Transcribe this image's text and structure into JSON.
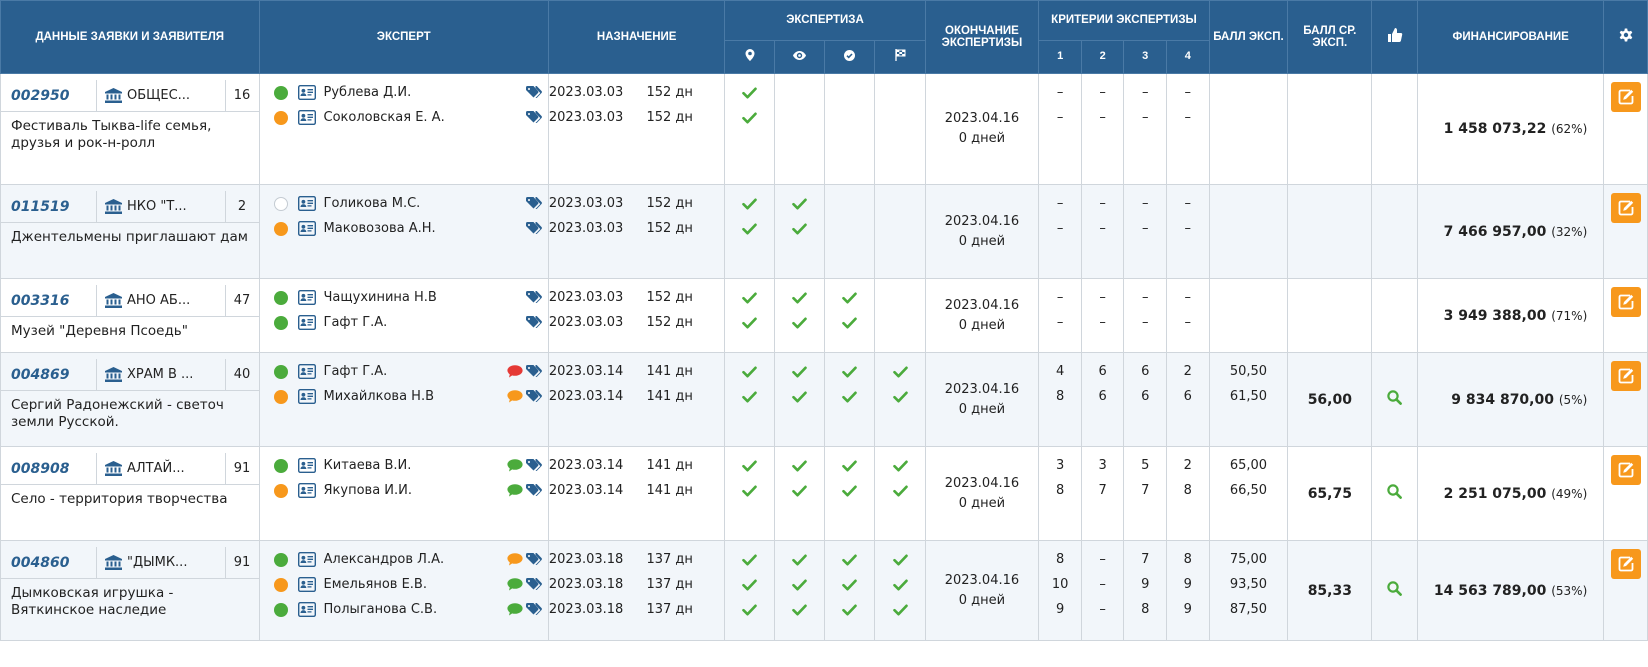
{
  "header": {
    "applicant": "ДАННЫЕ ЗАЯВКИ И ЗАЯВИТЕЛЯ",
    "expert": "ЭКСПЕРТ",
    "assign": "НАЗНАЧЕНИЕ",
    "expertise": "ЭКСПЕРТИЗА",
    "end": "ОКОНЧАНИЕ ЭКСПЕРТИЗЫ",
    "criteria": "КРИТЕРИИ ЭКСПЕРТИЗЫ",
    "crit_nums": [
      "1",
      "2",
      "3",
      "4"
    ],
    "score": "БАЛЛ ЭКСП.",
    "avg_score": "БАЛЛ СР. ЭКСП.",
    "financing": "ФИНАНСИРОВАНИЕ",
    "icons": {
      "stage1": "location-pin-icon",
      "stage2": "eye-icon",
      "stage3": "check-circle-icon",
      "stage4": "flag-icon",
      "like": "thumbs-up-icon",
      "settings": "gear-icon"
    }
  },
  "colors": {
    "header_bg": "#2a5f8f",
    "green": "#4bab3c",
    "orange": "#f7981c",
    "check": "#4bab3c",
    "tag": "#2a5f8f",
    "comment_red": "#e53935",
    "comment_orange": "#f7981c",
    "comment_green": "#4bab3c",
    "link": "#2a5f8f"
  },
  "rows": [
    {
      "code": "002950",
      "org": "ОБЩЕС...",
      "num": "16",
      "title": "Фестиваль Тыква-life семья, друзья и рок-н-ролл",
      "experts": [
        {
          "status": "green",
          "name": "Рублева Д.И.",
          "comment": "",
          "date": "2023.03.03",
          "days": "152 дн",
          "checks": [
            true,
            false,
            false,
            false
          ],
          "crit": [
            "–",
            "–",
            "–",
            "–"
          ],
          "score": ""
        },
        {
          "status": "orange",
          "name": "Соколовская Е. А.",
          "comment": "",
          "date": "2023.03.03",
          "days": "152 дн",
          "checks": [
            true,
            false,
            false,
            false
          ],
          "crit": [
            "–",
            "–",
            "–",
            "–"
          ],
          "score": ""
        }
      ],
      "end_date": "2023.04.16",
      "end_days": "0 дней",
      "avg": "",
      "search": false,
      "fin": "1 458 073,22",
      "pct": "(62%)"
    },
    {
      "code": "011519",
      "org": "НКО \"Т...",
      "num": "2",
      "title": "Джентельмены приглашают дам",
      "experts": [
        {
          "status": "empty",
          "name": "Голикова М.С.",
          "comment": "",
          "date": "2023.03.03",
          "days": "152 дн",
          "checks": [
            true,
            true,
            false,
            false
          ],
          "crit": [
            "–",
            "–",
            "–",
            "–"
          ],
          "score": ""
        },
        {
          "status": "orange",
          "name": "Маковозова А.Н.",
          "comment": "",
          "date": "2023.03.03",
          "days": "152 дн",
          "checks": [
            true,
            true,
            false,
            false
          ],
          "crit": [
            "–",
            "–",
            "–",
            "–"
          ],
          "score": ""
        }
      ],
      "end_date": "2023.04.16",
      "end_days": "0 дней",
      "avg": "",
      "search": false,
      "fin": "7 466 957,00",
      "pct": "(32%)"
    },
    {
      "code": "003316",
      "org": "АНО АБ...",
      "num": "47",
      "title": "Музей \"Деревня Псоедь\"",
      "experts": [
        {
          "status": "green",
          "name": "Чащухинина Н.В",
          "comment": "",
          "date": "2023.03.03",
          "days": "152 дн",
          "checks": [
            true,
            true,
            true,
            false
          ],
          "crit": [
            "–",
            "–",
            "–",
            "–"
          ],
          "score": ""
        },
        {
          "status": "green",
          "name": "Гафт Г.А.",
          "comment": "",
          "date": "2023.03.03",
          "days": "152 дн",
          "checks": [
            true,
            true,
            true,
            false
          ],
          "crit": [
            "–",
            "–",
            "–",
            "–"
          ],
          "score": ""
        }
      ],
      "end_date": "2023.04.16",
      "end_days": "0 дней",
      "avg": "",
      "search": false,
      "fin": "3 949 388,00",
      "pct": "(71%)"
    },
    {
      "code": "004869",
      "org": "ХРАМ В ...",
      "num": "40",
      "title": "Сергий Радонежский - светоч земли Русской.",
      "experts": [
        {
          "status": "green",
          "name": "Гафт Г.А.",
          "comment": "red",
          "date": "2023.03.14",
          "days": "141 дн",
          "checks": [
            true,
            true,
            true,
            true
          ],
          "crit": [
            "4",
            "6",
            "6",
            "2"
          ],
          "score": "50,50"
        },
        {
          "status": "orange",
          "name": "Михайлкова Н.В",
          "comment": "orange",
          "date": "2023.03.14",
          "days": "141 дн",
          "checks": [
            true,
            true,
            true,
            true
          ],
          "crit": [
            "8",
            "6",
            "6",
            "6"
          ],
          "score": "61,50"
        }
      ],
      "end_date": "2023.04.16",
      "end_days": "0 дней",
      "avg": "56,00",
      "search": true,
      "fin": "9 834 870,00",
      "pct": "(5%)"
    },
    {
      "code": "008908",
      "org": "АЛТАЙ...",
      "num": "91",
      "title": "Село - территория творчества",
      "experts": [
        {
          "status": "green",
          "name": "Китаева В.И.",
          "comment": "green",
          "date": "2023.03.14",
          "days": "141 дн",
          "checks": [
            true,
            true,
            true,
            true
          ],
          "crit": [
            "3",
            "3",
            "5",
            "2"
          ],
          "score": "65,00"
        },
        {
          "status": "orange",
          "name": "Якупова И.И.",
          "comment": "green",
          "date": "2023.03.14",
          "days": "141 дн",
          "checks": [
            true,
            true,
            true,
            true
          ],
          "crit": [
            "8",
            "7",
            "7",
            "8"
          ],
          "score": "66,50"
        }
      ],
      "end_date": "2023.04.16",
      "end_days": "0 дней",
      "avg": "65,75",
      "search": true,
      "fin": "2 251 075,00",
      "pct": "(49%)"
    },
    {
      "code": "004860",
      "org": "\"ДЫМК...",
      "num": "91",
      "title": "Дымковская игрушка - Вяткинское наследие",
      "experts": [
        {
          "status": "green",
          "name": "Александров Л.А.",
          "comment": "orange",
          "date": "2023.03.18",
          "days": "137 дн",
          "checks": [
            true,
            true,
            true,
            true
          ],
          "crit": [
            "8",
            "–",
            "7",
            "8"
          ],
          "score": "75,00"
        },
        {
          "status": "orange",
          "name": "Емельянов Е.В.",
          "comment": "green",
          "date": "2023.03.18",
          "days": "137 дн",
          "checks": [
            true,
            true,
            true,
            true
          ],
          "crit": [
            "10",
            "–",
            "9",
            "9"
          ],
          "score": "93,50"
        },
        {
          "status": "green",
          "name": "Полыганова С.В.",
          "comment": "green",
          "date": "2023.03.18",
          "days": "137 дн",
          "checks": [
            true,
            true,
            true,
            true
          ],
          "crit": [
            "9",
            "–",
            "8",
            "9"
          ],
          "score": "87,50"
        }
      ],
      "end_date": "2023.04.16",
      "end_days": "0 дней",
      "avg": "85,33",
      "search": true,
      "fin": "14 563 789,00",
      "pct": "(53%)"
    }
  ]
}
